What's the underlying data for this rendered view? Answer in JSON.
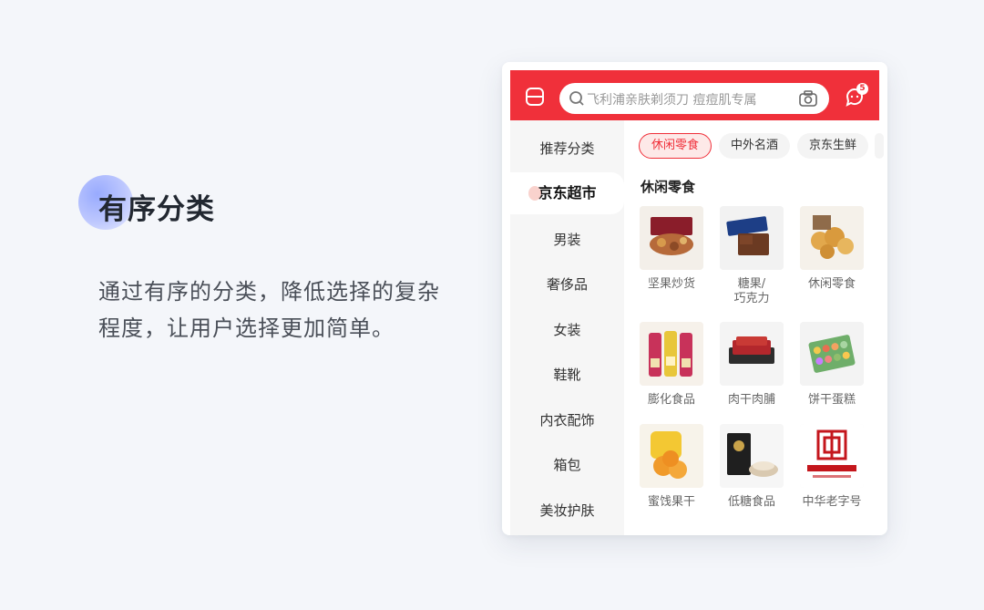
{
  "hero": {
    "title": "有序分类",
    "description": "通过有序的分类，降低选择的复杂程度，让用户选择更加简单。"
  },
  "app": {
    "brand_color": "#f0303a",
    "search": {
      "placeholder": "飞利浦亲肤剃须刀 痘痘肌专属"
    },
    "message_badge": "5"
  },
  "sidebar": {
    "items": [
      {
        "label": "推荐分类",
        "active": false
      },
      {
        "label": "京东超市",
        "active": true
      },
      {
        "label": "男装",
        "active": false
      },
      {
        "label": "奢侈品",
        "active": false
      },
      {
        "label": "女装",
        "active": false
      },
      {
        "label": "鞋靴",
        "active": false
      },
      {
        "label": "内衣配饰",
        "active": false
      },
      {
        "label": "箱包",
        "active": false
      },
      {
        "label": "美妆护肤",
        "active": false
      }
    ]
  },
  "chips": [
    {
      "label": "休闲零食",
      "active": true
    },
    {
      "label": "中外名酒",
      "active": false
    },
    {
      "label": "京东生鲜",
      "active": false
    }
  ],
  "section": {
    "title": "休闲零食",
    "items": [
      {
        "label": "坚果炒货",
        "icon": "nuts-product-image"
      },
      {
        "label": "糖果/\n巧克力",
        "icon": "chocolate-product-image"
      },
      {
        "label": "休闲零食",
        "icon": "snack-balls-product-image"
      },
      {
        "label": "膨化食品",
        "icon": "chips-product-image"
      },
      {
        "label": "肉干肉脯",
        "icon": "jerky-product-image"
      },
      {
        "label": "饼干蛋糕",
        "icon": "macaron-product-image"
      },
      {
        "label": "蜜饯果干",
        "icon": "dried-fruit-product-image"
      },
      {
        "label": "低糖食品",
        "icon": "low-sugar-product-image"
      },
      {
        "label": "中华老字号",
        "icon": "time-honored-brand-image"
      }
    ]
  }
}
